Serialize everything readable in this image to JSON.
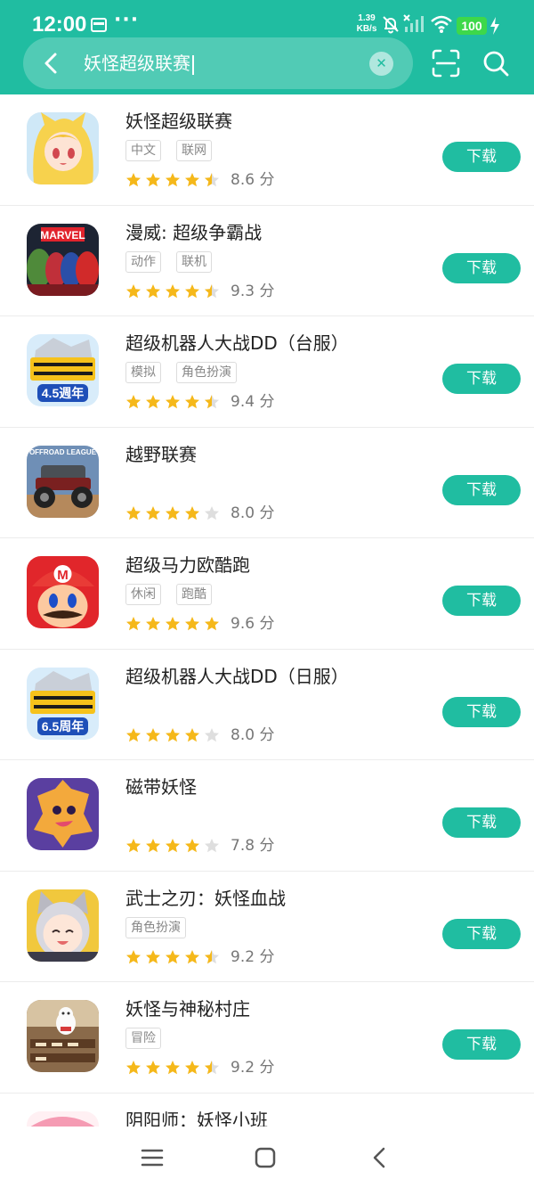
{
  "status_bar": {
    "time": "12:00",
    "dots": "···",
    "net_speed_value": "1.39",
    "net_speed_unit": "KB/s",
    "battery": "100",
    "icons": [
      "calendar-icon",
      "bell-muted-icon",
      "signal-icon",
      "wifi-icon",
      "charging-icon"
    ]
  },
  "search": {
    "query": "妖怪超级联赛"
  },
  "colors": {
    "accent": "#20bda1",
    "star": "#f5b81a",
    "star_empty": "#dedede"
  },
  "apps": [
    {
      "name": "妖怪超级联赛",
      "tags": [
        "中文",
        "联网"
      ],
      "rating": 4.5,
      "score": "8.6 分",
      "button": "下载",
      "icon": "anime-girl-icon"
    },
    {
      "name": "漫威: 超级争霸战",
      "tags": [
        "动作",
        "联机"
      ],
      "rating": 4.5,
      "score": "9.3 分",
      "button": "下载",
      "icon": "marvel-heroes-icon",
      "icon_text": "MARVEL"
    },
    {
      "name": "超级机器人大战DD（台服）",
      "tags": [
        "模拟",
        "角色扮演"
      ],
      "rating": 4.5,
      "score": "9.4 分",
      "button": "下载",
      "icon": "robot-anniversary-icon",
      "icon_text": "4.5週年"
    },
    {
      "name": "越野联赛",
      "tags": [],
      "rating": 4,
      "score": "8.0 分",
      "button": "下载",
      "icon": "offroad-truck-icon",
      "icon_text": "OFFROAD LEAGUE"
    },
    {
      "name": "超级马力欧酷跑",
      "tags": [
        "休闲",
        "跑酷"
      ],
      "rating": 5,
      "score": "9.6 分",
      "button": "下载",
      "icon": "mario-icon"
    },
    {
      "name": "超级机器人大战DD（日服）",
      "tags": [],
      "rating": 4,
      "score": "8.0 分",
      "button": "下载",
      "icon": "robot-anniversary-icon",
      "icon_text": "6.5周年"
    },
    {
      "name": "磁带妖怪",
      "tags": [],
      "rating": 4,
      "score": "7.8 分",
      "button": "下载",
      "icon": "cassette-monster-icon"
    },
    {
      "name": "武士之刃：妖怪血战",
      "tags": [
        "角色扮演"
      ],
      "rating": 4.5,
      "score": "9.2 分",
      "button": "下载",
      "icon": "cat-ear-girl-icon"
    },
    {
      "name": "妖怪与神秘村庄",
      "tags": [
        "冒险"
      ],
      "rating": 4.5,
      "score": "9.2 分",
      "button": "下载",
      "icon": "lucky-cat-shop-icon"
    },
    {
      "name": "阴阳师：妖怪小班",
      "tags": [],
      "rating": null,
      "score": "",
      "button": "",
      "icon": "pink-chibi-icon"
    }
  ],
  "nav": {
    "items": [
      "menu-icon",
      "home-icon",
      "back-icon"
    ]
  }
}
